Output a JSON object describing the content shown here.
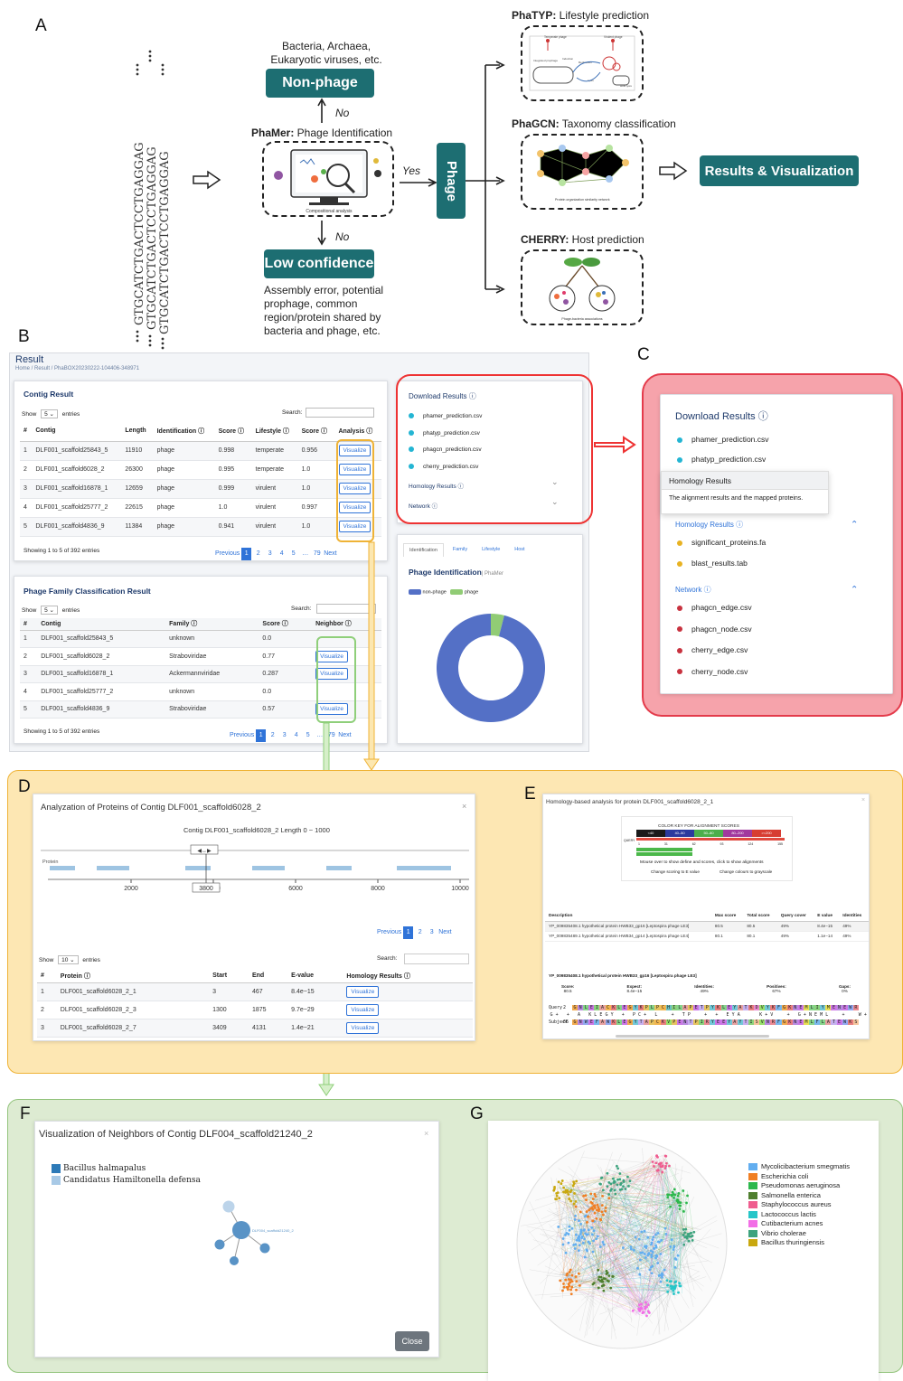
{
  "labels": {
    "a": "A",
    "b": "B",
    "c": "C",
    "d": "D",
    "e": "E",
    "f": "F",
    "g": "G"
  },
  "panelA": {
    "seq1": "GTGCATCTGACTCCTGAGGAG",
    "seq2": "GTGCATCTGACTCCTGAGGAG",
    "seq3": "GTGCATCTGACTCCTGAGGAG",
    "dots": "…",
    "nonphage_desc": "Bacteria, Archaea,\nEukaryotic viruses, etc.",
    "nonphage": "Non-phage",
    "no": "No",
    "no2": "No",
    "phamer_bold": "PhaMer:",
    "phamer_rest": " Phage Identification",
    "phamer_caption": "Compositional analysis",
    "yes": "Yes",
    "phage": "Phage",
    "low": "Low confidence",
    "low_desc": "Assembly error, potential\nprophage, common\nregion/protein shared by\nbacteria and phage, etc.",
    "phatyp_bold": "PhaTYP:",
    "phatyp_rest": " Lifestyle prediction",
    "phagcn_bold": "PhaGCN:",
    "phagcn_rest": " Taxonomy classification",
    "phagcn_caption": "Protein organization similarity network",
    "cherry_bold": "CHERRY:",
    "cherry_rest": " Host prediction",
    "cherry_caption": "Phage-bacteria associations",
    "phatyp_mini": [
      "Temperate phage",
      "Virulent phage",
      "Integrated prophage",
      "Induction",
      "Replication",
      "Lysis",
      "Host lysis"
    ],
    "results": "Results & Visualization"
  },
  "panelB": {
    "title": "Result",
    "breadcrumb": "Home / Result / PhaBOX20230222-104406-348971",
    "contig": {
      "title": "Contig Result",
      "show": "Show",
      "show_val": "5",
      "entries": "entries",
      "search": "Search:",
      "headers": [
        "#",
        "Contig",
        "Length",
        "Identification ⓘ",
        "Score ⓘ",
        "Lifestyle ⓘ",
        "Score ⓘ",
        "Analysis ⓘ"
      ],
      "rows": [
        [
          "1",
          "DLF001_scaffold25843_5",
          "11910",
          "phage",
          "0.998",
          "temperate",
          "0.956"
        ],
        [
          "2",
          "DLF001_scaffold6028_2",
          "26300",
          "phage",
          "0.995",
          "temperate",
          "1.0"
        ],
        [
          "3",
          "DLF001_scaffold16878_1",
          "12659",
          "phage",
          "0.999",
          "virulent",
          "1.0"
        ],
        [
          "4",
          "DLF001_scaffold25777_2",
          "22615",
          "phage",
          "1.0",
          "virulent",
          "0.997"
        ],
        [
          "5",
          "DLF001_scaffold4836_9",
          "11384",
          "phage",
          "0.941",
          "virulent",
          "1.0"
        ]
      ],
      "btn": "Visualize",
      "footer": "Showing 1 to 5 of 392 entries",
      "pager": [
        "Previous",
        "1",
        "2",
        "3",
        "4",
        "5",
        "…",
        "79",
        "Next"
      ]
    },
    "family": {
      "title": "Phage Family Classification Result",
      "show": "Show",
      "show_val": "5",
      "entries": "entries",
      "search": "Search:",
      "headers": [
        "#",
        "Contig",
        "Family ⓘ",
        "Score ⓘ",
        "Neighbor ⓘ"
      ],
      "rows": [
        [
          "1",
          "DLF001_scaffold25843_5",
          "unknown",
          "0.0",
          ""
        ],
        [
          "2",
          "DLF001_scaffold6028_2",
          "Straboviridae",
          "0.77",
          "Visualize"
        ],
        [
          "3",
          "DLF001_scaffold16878_1",
          "Ackermannviridae",
          "0.287",
          "Visualize"
        ],
        [
          "4",
          "DLF001_scaffold25777_2",
          "unknown",
          "0.0",
          ""
        ],
        [
          "5",
          "DLF001_scaffold4836_9",
          "Straboviridae",
          "0.57",
          "Visualize"
        ]
      ],
      "footer": "Showing 1 to 5 of 392 entries",
      "pager": [
        "Previous",
        "1",
        "2",
        "3",
        "4",
        "5",
        "…",
        "79",
        "Next"
      ]
    },
    "download": {
      "title": "Download Results ⓘ",
      "files": [
        "phamer_prediction.csv",
        "phatyp_prediction.csv",
        "phagcn_prediction.csv",
        "cherry_prediction.csv"
      ],
      "homology": "Homology Results ⓘ",
      "network": "Network ⓘ"
    },
    "ident": {
      "tabs": [
        "Identification",
        "Family",
        "Lifestyle",
        "Host"
      ],
      "title": "Phage Identification",
      "sub": "| PhaMer",
      "legend": [
        "non-phage",
        "phage"
      ]
    }
  },
  "chart_data": {
    "type": "pie",
    "categories": [
      "non-phage",
      "phage"
    ],
    "values": [
      96,
      4
    ],
    "colors": [
      "#5470c6",
      "#91cc75"
    ]
  },
  "panelC": {
    "title": "Download Results ⓘ",
    "files": [
      "phamer_prediction.csv",
      "phatyp_prediction.csv"
    ],
    "tip_title": "Homology Results",
    "tip_text": "The alignment results and the mapped proteins.",
    "homology": "Homology Results ⓘ",
    "homology_files": [
      "significant_proteins.fa",
      "blast_results.tab"
    ],
    "network": "Network ⓘ",
    "network_files": [
      "phagcn_edge.csv",
      "phagcn_node.csv",
      "cherry_edge.csv",
      "cherry_node.csv"
    ]
  },
  "panelD": {
    "title": "Analyzation of Proteins of Contig DLF001_scaffold6028_2",
    "close": "×",
    "plot_title": "Contig DLF001_scaffold6028_2 Length 0 ~ 1000",
    "track": "Protein",
    "cursor": "3800",
    "ticks": [
      "2000",
      "4000",
      "6000",
      "8000",
      "10000"
    ],
    "pager": [
      "Previous",
      "1",
      "2",
      "3",
      "Next"
    ],
    "show": "Show",
    "show_val": "10",
    "entries": "entries",
    "search": "Search:",
    "headers": [
      "#",
      "Protein ⓘ",
      "Start",
      "End",
      "E-value",
      "Homology Results ⓘ"
    ],
    "rows": [
      [
        "1",
        "DLF001_scaffold6028_2_1",
        "3",
        "467",
        "8.4e−15"
      ],
      [
        "2",
        "DLF001_scaffold6028_2_3",
        "1300",
        "1875",
        "9.7e−29"
      ],
      [
        "3",
        "DLF001_scaffold6028_2_7",
        "3409",
        "4131",
        "1.4e−21"
      ]
    ],
    "btn": "Visualize"
  },
  "panelE": {
    "title": "Homology-based analysis for protein DLF001_scaffold6028_2_1",
    "close": "×",
    "colorkey": "COLOR KEY FOR ALIGNMENT SCORES",
    "keys": [
      "<40",
      "40–50",
      "50–80",
      "80–200",
      ">=200"
    ],
    "query": "QUERY",
    "axis": [
      "1",
      "31",
      "62",
      "93",
      "124",
      "155"
    ],
    "hint": "Mouse over to show define and scores, click to show alignments",
    "opt1": "Change scoring to E value",
    "opt2": "Change colours to grayscale",
    "headers": [
      "Description",
      "Max score",
      "Total score",
      "Query cover",
      "E value",
      "Identities"
    ],
    "rows": [
      [
        "YP_009835408.1 hypothetical protein HWB33_gp16 [Leptospira phage LE3]",
        "80.5",
        "80.5",
        "49%",
        "8.4e−15",
        "49%"
      ],
      [
        "YP_009835489.1 hypothetical protein HWB34_gp14 [Leptospira phage LE4]",
        "80.1",
        "80.1",
        "49%",
        "1.1e−14",
        "49%"
      ]
    ],
    "aln_title": "YP_009835408.1 hypothetical protein HWB33_gp16 [Leptospira phage LE3]",
    "stats_h": [
      "Score:",
      "Expect:",
      "Identities:",
      "Positives:",
      "Gaps:"
    ],
    "stats_v": [
      "80.5",
      "8.4e−15",
      "49%",
      "67%",
      "0%"
    ],
    "q_label": "Query",
    "q_num": "2",
    "s_label": "Subject",
    "s_num": "66",
    "qseq": "GNLEIACKLEGYKPLPCHILAPETPYKLEYATKDVYKFGKNEMLIYMENEWR",
    "mseq": "G+ + A KLEGY + PC+ L  + TP  + + EYA   K+V  + G+NEML  +  W+ ",
    "sseq": "GNWEFAWKLEGYTAPCKVPENTPIRYEEYAYTISVNRFGKNEMLFLATEWKS"
  },
  "panelF": {
    "title": "Visualization of Neighbors of Contig DLF004_scaffold21240_2",
    "close": "×",
    "legend": [
      "Bacillus halmapalus",
      "Candidatus Hamiltonella defensa"
    ],
    "node_label": "DLF004_scaffold21240_2",
    "btn": "Close"
  },
  "panelG": {
    "legend": [
      "Mycolicibacterium smegmatis",
      "Escherichia coli",
      "Pseudomonas aeruginosa",
      "Salmonella enterica",
      "Staphylococcus aureus",
      "Lactococcus lactis",
      "Cutibacterium acnes",
      "Vibrio cholerae",
      "Bacillus thuringiensis"
    ],
    "colors": [
      "#62aef0",
      "#f07f24",
      "#2db84d",
      "#4f7f2e",
      "#ef5d8f",
      "#26c6c8",
      "#f26ee6",
      "#3da37e",
      "#c9a80f"
    ]
  }
}
